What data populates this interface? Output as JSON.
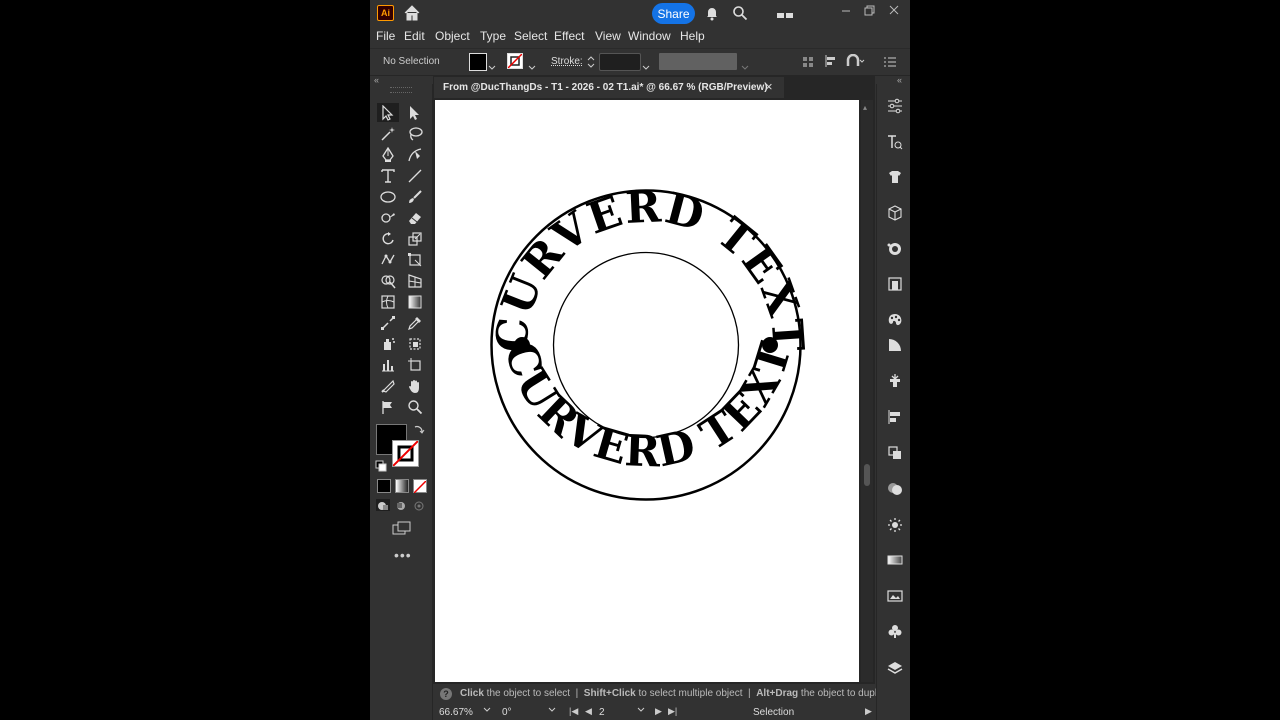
{
  "app": {
    "logo": "Ai",
    "share_label": "Share",
    "accent": "#1473e6"
  },
  "menu": [
    "File",
    "Edit",
    "Object",
    "Type",
    "Select",
    "Effect",
    "View",
    "Window",
    "Help"
  ],
  "control": {
    "selection_label": "No Selection",
    "stroke_label": "Stroke:"
  },
  "document": {
    "tab_title": "From @DucThangDs - T1 - 2026 - 02 T1.ai* @ 66.67 % (RGB/Preview)",
    "close_glyph": "×"
  },
  "artwork": {
    "top_text": "CURVERD TEXT",
    "bottom_text": "CURVERD TEXT"
  },
  "status": {
    "hint_1_bold": "Click",
    "hint_1": " the object to select  |  ",
    "hint_2_bold": "Shift+Click",
    "hint_2": " to select multiple object  |  ",
    "hint_3_bold": "Alt+Drag",
    "hint_3": " the object to duplicate"
  },
  "bottom": {
    "zoom": "66.67%",
    "rotation": "0°",
    "artboard": "2",
    "tool_name": "Selection"
  },
  "icons": {
    "left_tools": [
      "selection-tool-icon",
      "direct-selection-tool-icon",
      "magic-wand-icon",
      "lasso-icon",
      "pen-icon",
      "curvature-icon",
      "type-icon",
      "line-icon",
      "ellipse-icon",
      "paintbrush-icon",
      "shaper-icon",
      "eraser-icon",
      "rotate-icon",
      "scale-icon",
      "puppet-warp-icon",
      "free-transform-icon",
      "shape-builder-icon",
      "perspective-icon",
      "mesh-icon",
      "gradient-icon",
      "blend-icon",
      "eyedropper-icon",
      "symbol-sprayer-icon",
      "live-paint-icon",
      "graph-icon",
      "artboard-icon",
      "slice-icon",
      "hand-icon",
      "layer-flag-icon",
      "zoom-icon"
    ],
    "right_panels": [
      "properties-icon",
      "type-panel-icon",
      "libraries-icon",
      "3d-icon",
      "appearance-icon",
      "artboards-icon",
      "color-icon",
      "color-guide-icon",
      "brushes-icon",
      "align-icon",
      "transform-icon",
      "pathfinder-icon",
      "symbols-icon",
      "gradient-panel-icon",
      "image-trace-icon",
      "graphic-styles-icon",
      "layers-icon"
    ]
  }
}
